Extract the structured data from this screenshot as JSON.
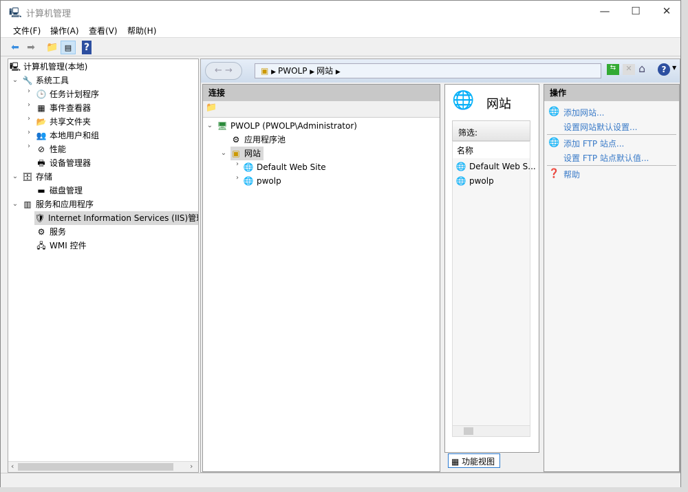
{
  "window": {
    "title": "计算机管理",
    "minimize": "—",
    "maximize": "☐",
    "close": "✕"
  },
  "menu": [
    "文件(F)",
    "操作(A)",
    "查看(V)",
    "帮助(H)"
  ],
  "tree": [
    {
      "label": "计算机管理(本地)"
    },
    {
      "label": "系统工具"
    },
    {
      "label": "任务计划程序"
    },
    {
      "label": "事件查看器"
    },
    {
      "label": "共享文件夹"
    },
    {
      "label": "本地用户和组"
    },
    {
      "label": "性能"
    },
    {
      "label": "设备管理器"
    },
    {
      "label": "存储"
    },
    {
      "label": "磁盘管理"
    },
    {
      "label": "服务和应用程序"
    },
    {
      "label": "Internet Information Services (IIS)管理"
    },
    {
      "label": "服务"
    },
    {
      "label": "WMI 控件"
    }
  ],
  "iis": {
    "breadcrumb": [
      "PWOLP",
      "网站"
    ],
    "connections": {
      "title": "连接",
      "items": [
        "PWOLP (PWOLP\\Administrator)",
        "应用程序池",
        "网站",
        "Default Web Site",
        "pwolp"
      ]
    },
    "center": {
      "title": "网站",
      "filter": "筛选:",
      "column": "名称",
      "rows": [
        "Default Web S...",
        "pwolp"
      ],
      "view_button": "功能视图"
    },
    "actions": {
      "title": "操作",
      "items": [
        "添加网站...",
        "设置网站默认设置...",
        "添加 FTP 站点...",
        "设置 FTP 站点默认值...",
        "帮助"
      ]
    }
  }
}
